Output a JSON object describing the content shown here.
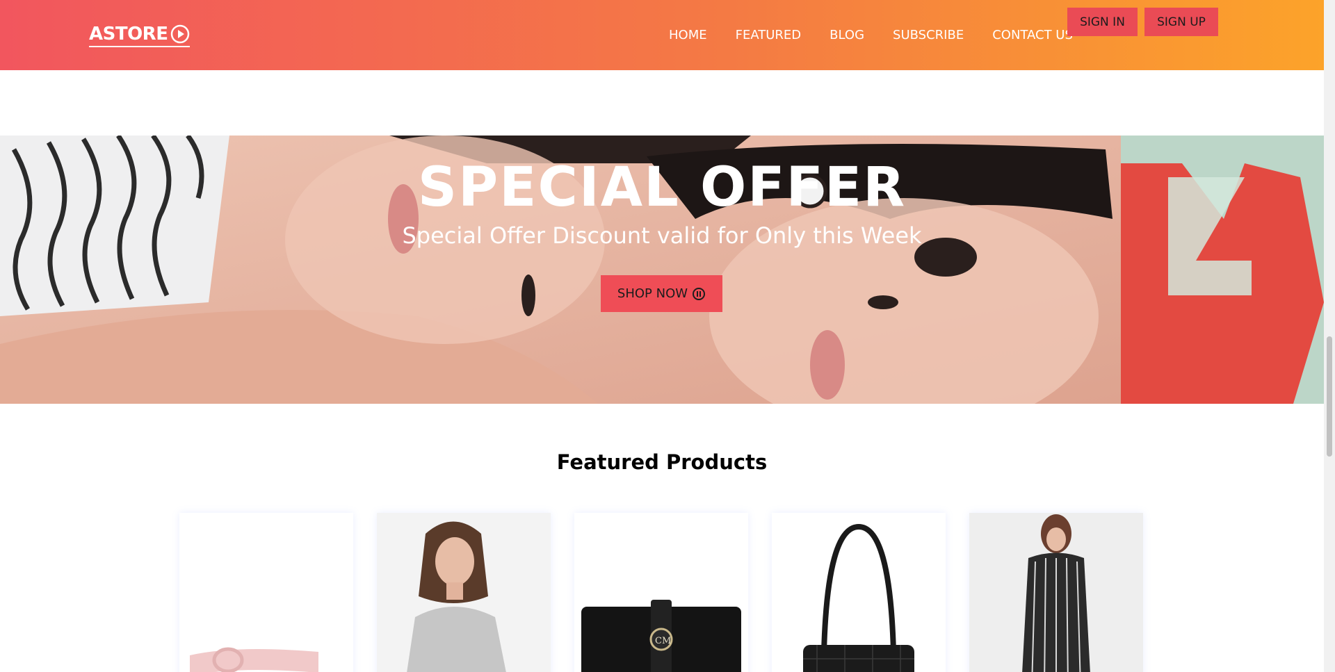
{
  "header": {
    "logo_text": "ASTORE",
    "logo_icon": "play-circle-icon",
    "nav": [
      "HOME",
      "FEATURED",
      "BLOG",
      "SUBSCRIBE",
      "CONTACT US"
    ],
    "sign_in": "SIGN IN",
    "sign_up": "SIGN UP",
    "gradient": [
      "#f2565e",
      "#fca32a"
    ],
    "button_color": "#ea4b55"
  },
  "hero": {
    "title": "SPECIAL OFFER",
    "subtitle": "Special Offer Discount valid for Only this Week",
    "button_label": "SHOP NOW",
    "button_icon": "pause-circle-icon",
    "button_color": "#ef4d56"
  },
  "featured": {
    "title": "Featured Products",
    "products": [
      {
        "image": "pink-belt"
      },
      {
        "image": "woman-grey-sweater"
      },
      {
        "image": "black-wallet"
      },
      {
        "image": "black-quilted-handbag"
      },
      {
        "image": "striped-outfit"
      }
    ]
  }
}
